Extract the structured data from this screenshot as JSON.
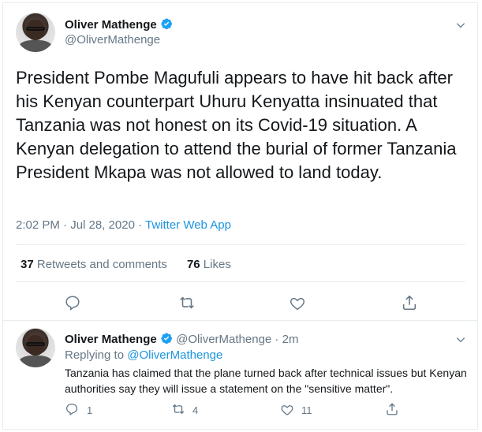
{
  "main_tweet": {
    "author_name": "Oliver Mathenge",
    "author_handle": "@OliverMathenge",
    "text": "President Pombe Magufuli appears to have hit back after his Kenyan counterpart Uhuru Kenyatta insinuated that Tanzania was not honest on its Covid-19 situation. A Kenyan delegation to attend the burial of former Tanzania President Mkapa was not allowed to land today.",
    "time": "2:02 PM · Jul 28, 2020 · ",
    "source_app": "Twitter Web App",
    "retweets_count": "37",
    "retweets_label": " Retweets and comments",
    "likes_count": "76",
    "likes_label": " Likes"
  },
  "reply": {
    "author_name": "Oliver Mathenge",
    "author_handle": "@OliverMathenge · 2m",
    "replying_prefix": "Replying to ",
    "replying_to": "@OliverMathenge",
    "text": "Tanzania has claimed that the plane turned back after technical issues but Kenyan authorities say they will issue a statement on the \"sensitive matter\".",
    "reply_count": "1",
    "retweet_count": "4",
    "like_count": "11"
  },
  "icons": {
    "verified": "verified-badge-icon",
    "menu": "chevron-down-icon",
    "reply": "reply-icon",
    "retweet": "retweet-icon",
    "like": "heart-icon",
    "share": "share-icon"
  },
  "colors": {
    "accent": "#1b95e0",
    "text": "#14171a",
    "muted": "#657786",
    "divider": "#e6ecf0"
  }
}
